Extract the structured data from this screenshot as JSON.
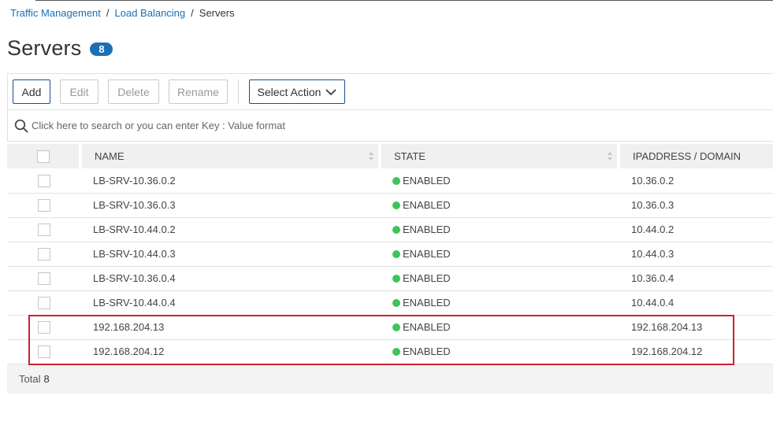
{
  "breadcrumb": {
    "items": [
      "Traffic Management",
      "Load Balancing",
      "Servers"
    ],
    "separator": "/"
  },
  "page": {
    "title": "Servers",
    "count": "8"
  },
  "toolbar": {
    "add": "Add",
    "edit": "Edit",
    "delete": "Delete",
    "rename": "Rename",
    "select_action": "Select Action"
  },
  "search": {
    "placeholder": "Click here to search or you can enter Key : Value format",
    "value": ""
  },
  "table": {
    "columns": [
      "NAME",
      "STATE",
      "IPADDRESS / DOMAIN"
    ],
    "rows": [
      {
        "name": "LB-SRV-10.36.0.2",
        "state": "ENABLED",
        "ip": "10.36.0.2"
      },
      {
        "name": "LB-SRV-10.36.0.3",
        "state": "ENABLED",
        "ip": "10.36.0.3"
      },
      {
        "name": "LB-SRV-10.44.0.2",
        "state": "ENABLED",
        "ip": "10.44.0.2"
      },
      {
        "name": "LB-SRV-10.44.0.3",
        "state": "ENABLED",
        "ip": "10.44.0.3"
      },
      {
        "name": "LB-SRV-10.36.0.4",
        "state": "ENABLED",
        "ip": "10.36.0.4"
      },
      {
        "name": "LB-SRV-10.44.0.4",
        "state": "ENABLED",
        "ip": "10.44.0.4"
      },
      {
        "name": "192.168.204.13",
        "state": "ENABLED",
        "ip": "192.168.204.13"
      },
      {
        "name": "192.168.204.12",
        "state": "ENABLED",
        "ip": "192.168.204.12"
      }
    ]
  },
  "footer": {
    "total_label": "Total",
    "total_value": "8"
  },
  "colors": {
    "link": "#1a6fb5",
    "status_enabled": "#3ec45b",
    "highlight": "#d0202b"
  },
  "icons": {
    "search": "search-icon",
    "dropdown": "chevron-down-icon",
    "sort": "sort-icon",
    "status": "status-dot-icon"
  }
}
